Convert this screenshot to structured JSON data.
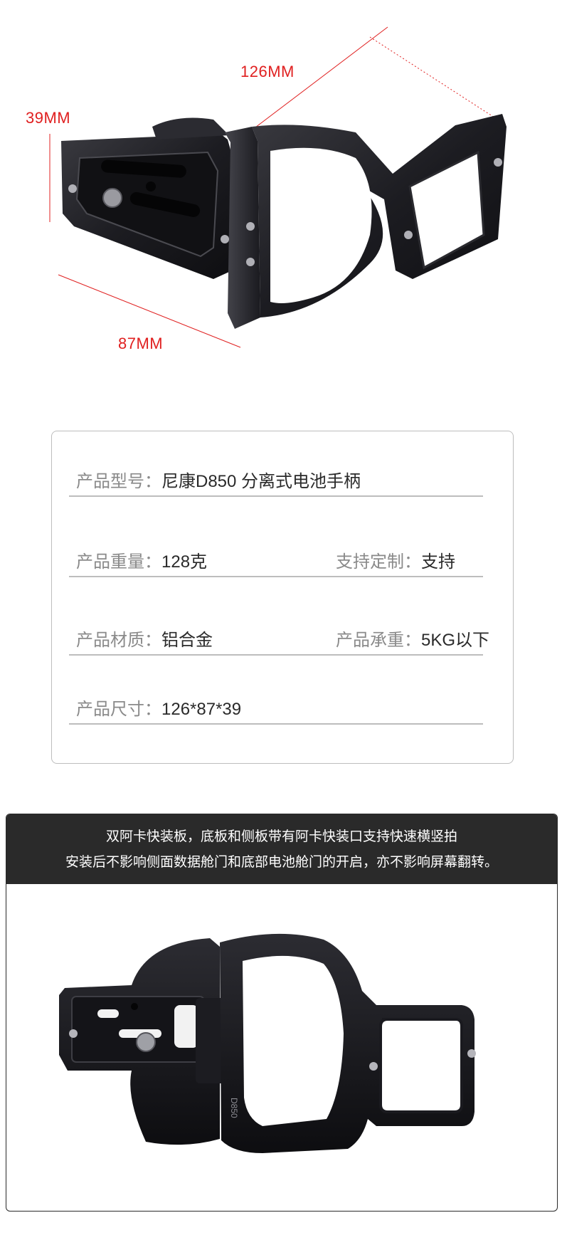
{
  "dimensions": {
    "length": "126MM",
    "height": "39MM",
    "width": "87MM"
  },
  "specs": {
    "model": {
      "label": "产品型号：",
      "value": "尼康D850 分离式电池手柄"
    },
    "weight": {
      "label": "产品重量：",
      "value": "128克"
    },
    "custom": {
      "label": "支持定制：",
      "value": "支持"
    },
    "material": {
      "label": "产品材质：",
      "value": "铝合金"
    },
    "load": {
      "label": "产品承重：",
      "value": "5KG以下"
    },
    "size": {
      "label": "产品尺寸：",
      "value": "126*87*39"
    }
  },
  "banner": {
    "line1": "双阿卡快装板，底板和侧板带有阿卡快装口支持快速横竖拍",
    "line2": "安装后不影响侧面数据舱门和底部电池舱门的开启，亦不影响屏幕翻转。"
  },
  "engraving": "D850",
  "colors": {
    "dimension_red": "#e02020",
    "banner_bg": "#2a2a2a",
    "product_black": "#1b1b1f"
  }
}
